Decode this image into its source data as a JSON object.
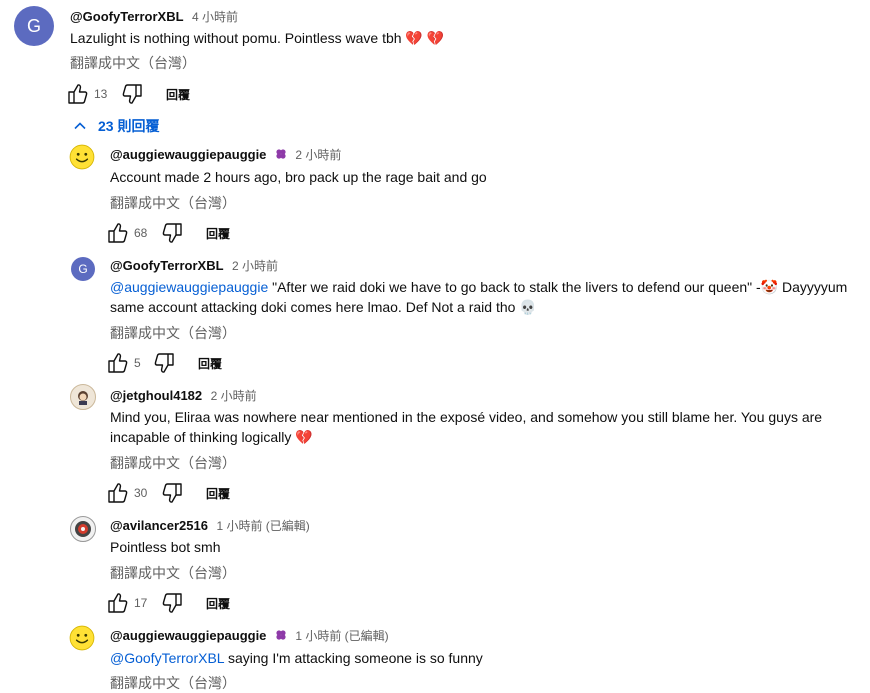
{
  "top_comment": {
    "avatar_letter": "G",
    "author": "@GoofyTerrorXBL",
    "time": "4 小時前",
    "text": "Lazulight is nothing without pomu. Pointless wave tbh",
    "emoji": "💔 💔",
    "translate": "翻譯成中文（台灣）",
    "likes": "13",
    "reply": "回覆"
  },
  "replies_toggle": {
    "label": "23 則回覆"
  },
  "replies": [
    {
      "author": "@auggiewauggiepauggie",
      "time": "2 小時前",
      "text": "Account made 2 hours ago, bro pack up the rage bait and go",
      "translate": "翻譯成中文（台灣）",
      "likes": "68",
      "reply": "回覆"
    },
    {
      "author": "@GoofyTerrorXBL",
      "time": "2 小時前",
      "mention": "@auggiewauggiepauggie",
      "text1": " \"After we raid doki we have to go back to stalk the livers to defend our queen\" -🤡  Dayyyyum",
      "text2": "same account attacking doki comes here lmao. Def Not a raid tho 💀",
      "translate": "翻譯成中文（台灣）",
      "likes": "5",
      "reply": "回覆",
      "avatar_letter": "G"
    },
    {
      "author": "@jetghoul4182",
      "time": "2 小時前",
      "text1": "Mind you, Eliraa was nowhere near mentioned in the exposé video, and somehow you still blame her. You guys are",
      "text2": "incapable of thinking logically 💔",
      "translate": "翻譯成中文（台灣）",
      "likes": "30",
      "reply": "回覆"
    },
    {
      "author": "@avilancer2516",
      "time": "1 小時前 (已編輯)",
      "text": "Pointless bot smh",
      "translate": "翻譯成中文（台灣）",
      "likes": "17",
      "reply": "回覆"
    },
    {
      "author": "@auggiewauggiepauggie",
      "time": "1 小時前 (已編輯)",
      "mention": "@GoofyTerrorXBL",
      "text": "  saying I'm attacking someone is so funny",
      "translate": "翻譯成中文（台灣）"
    }
  ]
}
